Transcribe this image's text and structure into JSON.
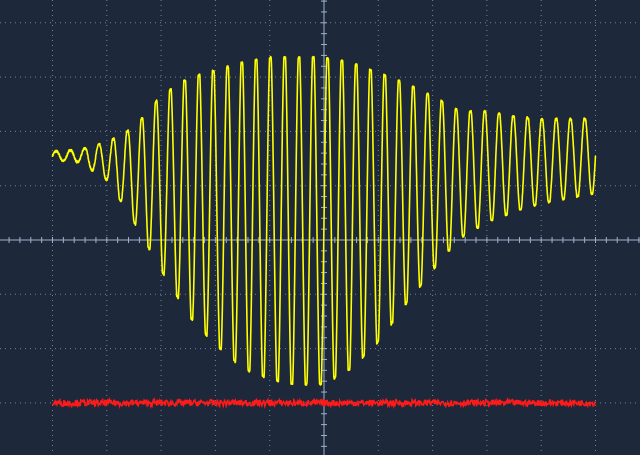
{
  "colors": {
    "background": "#1d283b",
    "grid": "#8ea2bf",
    "axis": "#9fb2cc",
    "channel_1": "#ffff00",
    "channel_2": "#ff1a1a"
  },
  "chart_data": {
    "type": "line",
    "grid": true,
    "xlim": [
      -5,
      5
    ],
    "ylim": [
      -3,
      5
    ],
    "series": [
      {
        "id": "ch1",
        "color": "#ffff00",
        "x": [
          -5.0,
          -4.5,
          -4.0,
          -3.5,
          -3.0,
          -2.5,
          -2.0,
          -1.5,
          -1.0,
          -0.5,
          0.0,
          0.5,
          1.0,
          1.5,
          2.0,
          2.5,
          3.0,
          3.5,
          4.0,
          4.5,
          5.0
        ],
        "center": [
          1.55,
          1.55,
          1.45,
          1.2,
          1.05,
          0.8,
          0.6,
          0.45,
          0.4,
          0.35,
          0.35,
          0.45,
          0.6,
          0.85,
          1.05,
          1.2,
          1.35,
          1.4,
          1.45,
          1.5,
          1.55
        ],
        "amplitude": [
          0.08,
          0.12,
          0.35,
          0.9,
          1.65,
          2.25,
          2.6,
          2.9,
          3.05,
          3.1,
          3.1,
          2.9,
          2.55,
          2.1,
          1.65,
          1.2,
          1.05,
          0.9,
          0.8,
          0.75,
          0.7
        ],
        "cycles_per_division": 3.8
      },
      {
        "id": "ch2",
        "color": "#ff1a1a",
        "level": -3.0,
        "noise": 0.06
      }
    ]
  }
}
